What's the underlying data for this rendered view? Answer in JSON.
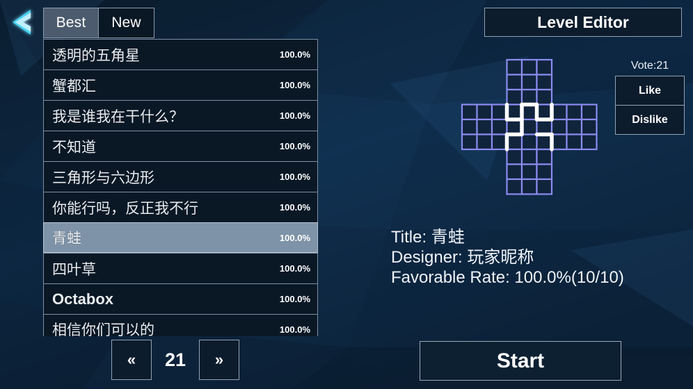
{
  "app": {
    "background_color": "#0d2238",
    "accent_color": "#4ad3f5",
    "grid_color": "#8b8bf0",
    "path_color": "#ffffff"
  },
  "nav": {
    "back_icon": "chevron-left-icon"
  },
  "tabs": [
    {
      "label": "Best",
      "active": true
    },
    {
      "label": "New",
      "active": false
    }
  ],
  "level_list": [
    {
      "title": "透明的五角星",
      "rate": "100.0%",
      "selected": false,
      "bold": false
    },
    {
      "title": "蟹都汇",
      "rate": "100.0%",
      "selected": false,
      "bold": false
    },
    {
      "title": "我是谁我在干什么？",
      "rate": "100.0%",
      "selected": false,
      "bold": false
    },
    {
      "title": "不知道",
      "rate": "100.0%",
      "selected": false,
      "bold": false
    },
    {
      "title": "三角形与六边形",
      "rate": "100.0%",
      "selected": false,
      "bold": false
    },
    {
      "title": "你能行吗，反正我不行",
      "rate": "100.0%",
      "selected": false,
      "bold": false
    },
    {
      "title": "青蛙",
      "rate": "100.0%",
      "selected": true,
      "bold": false
    },
    {
      "title": "四叶草",
      "rate": "100.0%",
      "selected": false,
      "bold": false
    },
    {
      "title": "Octabox",
      "rate": "100.0%",
      "selected": false,
      "bold": true
    },
    {
      "title": "相信你们可以的",
      "rate": "100.0%",
      "selected": false,
      "bold": false
    }
  ],
  "pagination": {
    "prev_label": "«",
    "next_label": "»",
    "page": "21"
  },
  "editor": {
    "title": "Level Editor"
  },
  "vote": {
    "count_label": "Vote:21",
    "like_label": "Like",
    "dislike_label": "Dislike"
  },
  "details": {
    "title_line": "Title: 青蛙",
    "designer_line": "Designer: 玩家昵称",
    "rate_line": "Favorable Rate: 100.0%(10/10)"
  },
  "start": {
    "label": "Start"
  },
  "puzzle_preview": {
    "shape": "plus-cross",
    "cell_size": 21.5,
    "grid_columns": 9,
    "grid_rows": 9,
    "arm_column_start": 3,
    "arm_column_end": 6,
    "band_row_start": 3,
    "band_row_end": 6,
    "path_segments": [
      [
        3,
        3,
        3,
        4
      ],
      [
        3,
        4,
        4,
        4
      ],
      [
        4,
        4,
        4,
        5
      ],
      [
        4,
        5,
        3,
        5
      ],
      [
        3,
        5,
        3,
        6
      ],
      [
        4,
        3,
        4,
        4
      ],
      [
        4,
        3,
        5,
        3
      ],
      [
        5,
        3,
        5,
        4
      ],
      [
        5,
        4,
        6,
        4
      ],
      [
        5,
        5,
        6,
        5
      ],
      [
        6,
        3,
        6,
        4
      ],
      [
        6,
        5,
        6,
        6
      ]
    ]
  }
}
